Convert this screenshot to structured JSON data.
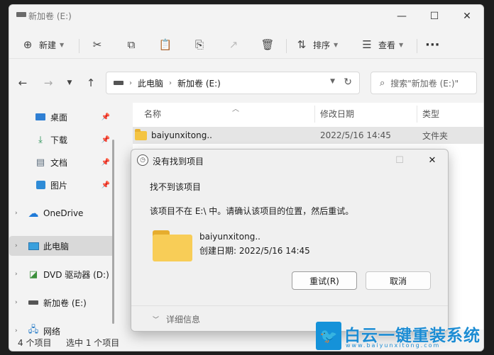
{
  "window": {
    "title": "新加卷 (E:)"
  },
  "window_controls": {
    "minimize": "—",
    "maximize": "☐",
    "close": "✕"
  },
  "toolbar": {
    "new_label": "新建",
    "sort_label": "排序",
    "view_label": "查看",
    "more_label": "···"
  },
  "address": {
    "crumbs": [
      "此电脑",
      "新加卷 (E:)"
    ],
    "search_placeholder": "搜索\"新加卷 (E:)\""
  },
  "sidebar": {
    "items": [
      {
        "label": "桌面",
        "icon": "desktop-icon",
        "pinned": true
      },
      {
        "label": "下载",
        "icon": "download-icon",
        "pinned": true
      },
      {
        "label": "文档",
        "icon": "document-icon",
        "pinned": true
      },
      {
        "label": "图片",
        "icon": "picture-icon",
        "pinned": true
      },
      {
        "label": "OneDrive",
        "icon": "cloud-icon",
        "pinned": false
      },
      {
        "label": "此电脑",
        "icon": "computer-icon",
        "pinned": false
      },
      {
        "label": "DVD 驱动器 (D:)",
        "icon": "dvd-icon",
        "pinned": false
      },
      {
        "label": "新加卷 (E:)",
        "icon": "drive-icon",
        "pinned": false
      },
      {
        "label": "网络",
        "icon": "network-icon",
        "pinned": false
      }
    ]
  },
  "columns": {
    "name": "名称",
    "modified": "修改日期",
    "type": "类型"
  },
  "files": [
    {
      "name": "baiyunxitong..",
      "modified": "2022/5/16 14:45",
      "type": "文件夹"
    }
  ],
  "status": {
    "count": "4 个项目",
    "selected": "选中 1 个项目"
  },
  "dialog": {
    "title": "没有找到项目",
    "heading": "找不到该项目",
    "message": "该项目不在 E:\\ 中。请确认该项目的位置，然后重试。",
    "item_name": "baiyunxitong..",
    "item_date": "创建日期: 2022/5/16 14:45",
    "retry_label": "重试(R)",
    "cancel_label": "取消",
    "details_label": "详细信息"
  },
  "watermark": {
    "text": "白云一键重装系统",
    "url": "www.baiyunxitong.com"
  },
  "colors": {
    "accent": "#1592d9",
    "folder": "#f8cd57",
    "selection": "#e5e5e5"
  }
}
